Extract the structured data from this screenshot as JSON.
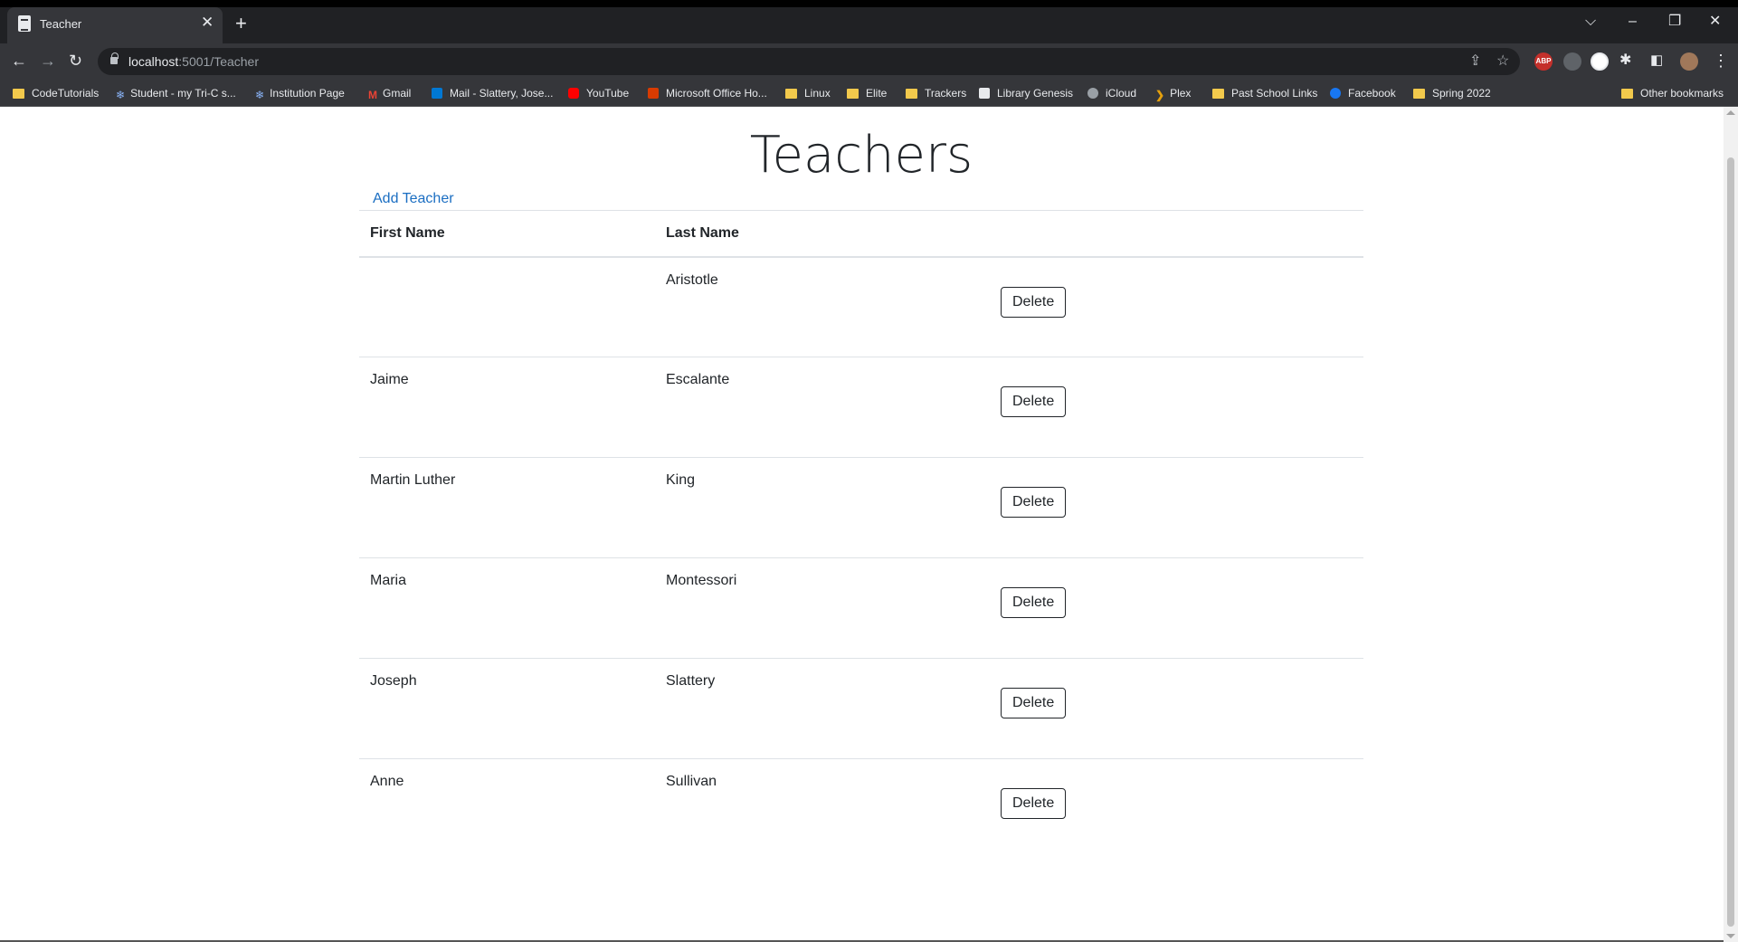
{
  "browser": {
    "tab_title": "Teacher",
    "url_host": "localhost",
    "url_path": ":5001/Teacher",
    "ext_abp": "ABP",
    "bookmarks": [
      {
        "label": "CodeTutorials",
        "icon": "folder-icon"
      },
      {
        "label": "Student - my Tri-C s...",
        "icon": "snowflake-icon"
      },
      {
        "label": "Institution Page",
        "icon": "snowflake-icon"
      },
      {
        "label": "Gmail",
        "icon": "gmail-icon"
      },
      {
        "label": "Mail - Slattery, Jose...",
        "icon": "outlook-icon"
      },
      {
        "label": "YouTube",
        "icon": "youtube-icon"
      },
      {
        "label": "Microsoft Office Ho...",
        "icon": "office-icon"
      },
      {
        "label": "Linux",
        "icon": "folder-icon"
      },
      {
        "label": "Elite",
        "icon": "folder-icon"
      },
      {
        "label": "Trackers",
        "icon": "folder-icon"
      },
      {
        "label": "Library Genesis",
        "icon": "library-icon"
      },
      {
        "label": "iCloud",
        "icon": "apple-icon"
      },
      {
        "label": "Plex",
        "icon": "plex-icon"
      },
      {
        "label": "Past School Links",
        "icon": "folder-icon"
      },
      {
        "label": "Facebook",
        "icon": "facebook-icon"
      },
      {
        "label": "Spring 2022",
        "icon": "folder-icon"
      }
    ],
    "other_bookmarks": "Other bookmarks"
  },
  "page": {
    "title": "Teachers",
    "add_link": "Add Teacher",
    "columns": [
      "First Name",
      "Last Name"
    ],
    "delete_label": "Delete",
    "rows": [
      {
        "first": "",
        "last": "Aristotle"
      },
      {
        "first": "Jaime",
        "last": "Escalante"
      },
      {
        "first": "Martin Luther",
        "last": "King"
      },
      {
        "first": "Maria",
        "last": "Montessori"
      },
      {
        "first": "Joseph",
        "last": "Slattery"
      },
      {
        "first": "Anne",
        "last": "Sullivan"
      }
    ]
  },
  "colors": {
    "link": "#1b6ec2",
    "chrome_dark": "#202124",
    "chrome_toolbar": "#35363a"
  }
}
